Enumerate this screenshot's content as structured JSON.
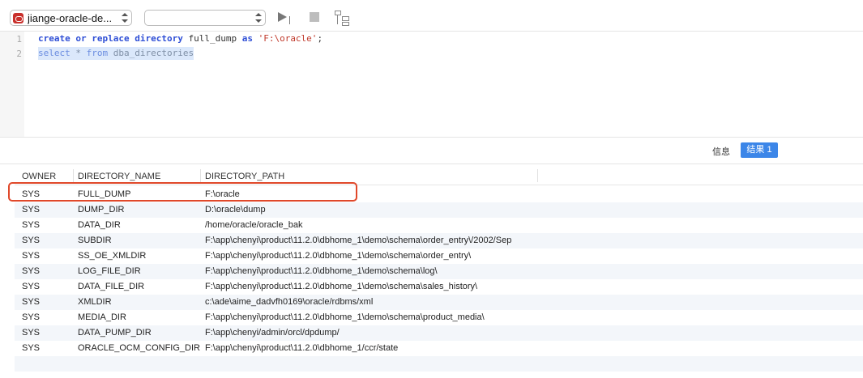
{
  "toolbar": {
    "connection_label": "jiange-oracle-de...",
    "database_value": "",
    "icons": [
      "database-icon",
      "run-icon",
      "stop-icon",
      "explain-icon"
    ]
  },
  "editor": {
    "line_numbers": [
      "1",
      "2"
    ],
    "line1": {
      "kw1": "create",
      "kw2": "or",
      "kw3": "replace",
      "kw4": "directory",
      "name": " full_dump ",
      "kw5": "as",
      "str": "'F:\\oracle'",
      "end": ";"
    },
    "line2": {
      "kw1": "select",
      "star": " * ",
      "kw2": "from",
      "table": " dba_directories"
    }
  },
  "result_tabs": {
    "info": "信息",
    "result": "结果 1"
  },
  "table": {
    "columns": [
      "OWNER",
      "DIRECTORY_NAME",
      "DIRECTORY_PATH"
    ],
    "rows": [
      [
        "SYS",
        "FULL_DUMP",
        "F:\\oracle"
      ],
      [
        "SYS",
        "DUMP_DIR",
        "D:\\oracle\\dump"
      ],
      [
        "SYS",
        "DATA_DIR",
        "/home/oracle/oracle_bak"
      ],
      [
        "SYS",
        "SUBDIR",
        "F:\\app\\chenyi\\product\\11.2.0\\dbhome_1\\demo\\schema\\order_entry\\/2002/Sep"
      ],
      [
        "SYS",
        "SS_OE_XMLDIR",
        "F:\\app\\chenyi\\product\\11.2.0\\dbhome_1\\demo\\schema\\order_entry\\"
      ],
      [
        "SYS",
        "LOG_FILE_DIR",
        "F:\\app\\chenyi\\product\\11.2.0\\dbhome_1\\demo\\schema\\log\\"
      ],
      [
        "SYS",
        "DATA_FILE_DIR",
        "F:\\app\\chenyi\\product\\11.2.0\\dbhome_1\\demo\\schema\\sales_history\\"
      ],
      [
        "SYS",
        "XMLDIR",
        "c:\\ade\\aime_dadvfh0169\\oracle/rdbms/xml"
      ],
      [
        "SYS",
        "MEDIA_DIR",
        "F:\\app\\chenyi\\product\\11.2.0\\dbhome_1\\demo\\schema\\product_media\\"
      ],
      [
        "SYS",
        "DATA_PUMP_DIR",
        "F:\\app\\chenyi/admin/orcl/dpdump/"
      ],
      [
        "SYS",
        "ORACLE_OCM_CONFIG_DIR",
        "F:\\app\\chenyi\\product\\11.2.0\\dbhome_1/ccr/state"
      ]
    ]
  },
  "colors": {
    "highlight": "#e0482a",
    "accent": "#3c86e8",
    "keyword": "#2f4fd6",
    "string": "#c0392b"
  }
}
